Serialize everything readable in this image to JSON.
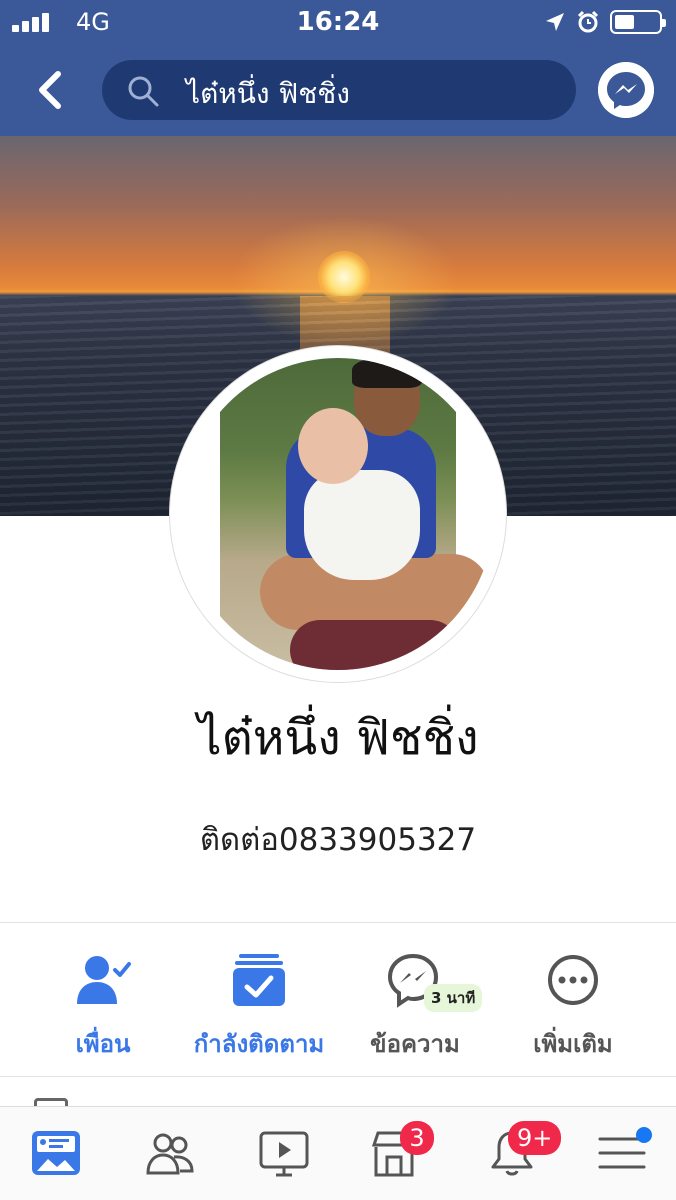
{
  "status_bar": {
    "carrier": "4G",
    "time": "16:24",
    "battery_level": 0.45
  },
  "header": {
    "search_text": "ไต๋หนึ่ง ฟิชชิ่ง",
    "icons": [
      "back-chevron-icon",
      "search-icon",
      "messenger-icon"
    ]
  },
  "profile": {
    "name": "ไต๋หนึ่ง ฟิชชิ่ง",
    "bio": "ติดต่อ0833905327"
  },
  "actions": [
    {
      "label": "เพื่อน",
      "icon": "friends-check-icon",
      "color": "#3b78e7"
    },
    {
      "label": "กำลังติดตาม",
      "icon": "following-box-icon",
      "color": "#3b78e7"
    },
    {
      "label": "ข้อความ",
      "icon": "messenger-icon",
      "badge": "3 นาที",
      "color": "#555555"
    },
    {
      "label": "เพิ่มเติม",
      "icon": "more-dots-icon",
      "color": "#555555"
    }
  ],
  "tabbar": {
    "items": [
      {
        "name": "news-feed",
        "icon": "news-feed-icon"
      },
      {
        "name": "friends",
        "icon": "friends-icon"
      },
      {
        "name": "watch",
        "icon": "watch-video-icon"
      },
      {
        "name": "marketplace",
        "icon": "marketplace-icon",
        "badge": "3"
      },
      {
        "name": "notifications",
        "icon": "bell-icon",
        "badge": "9+"
      },
      {
        "name": "menu",
        "icon": "menu-icon"
      }
    ]
  },
  "colors": {
    "brand": "#3b5998",
    "accent": "#3b78e7",
    "badge": "#f02849"
  }
}
